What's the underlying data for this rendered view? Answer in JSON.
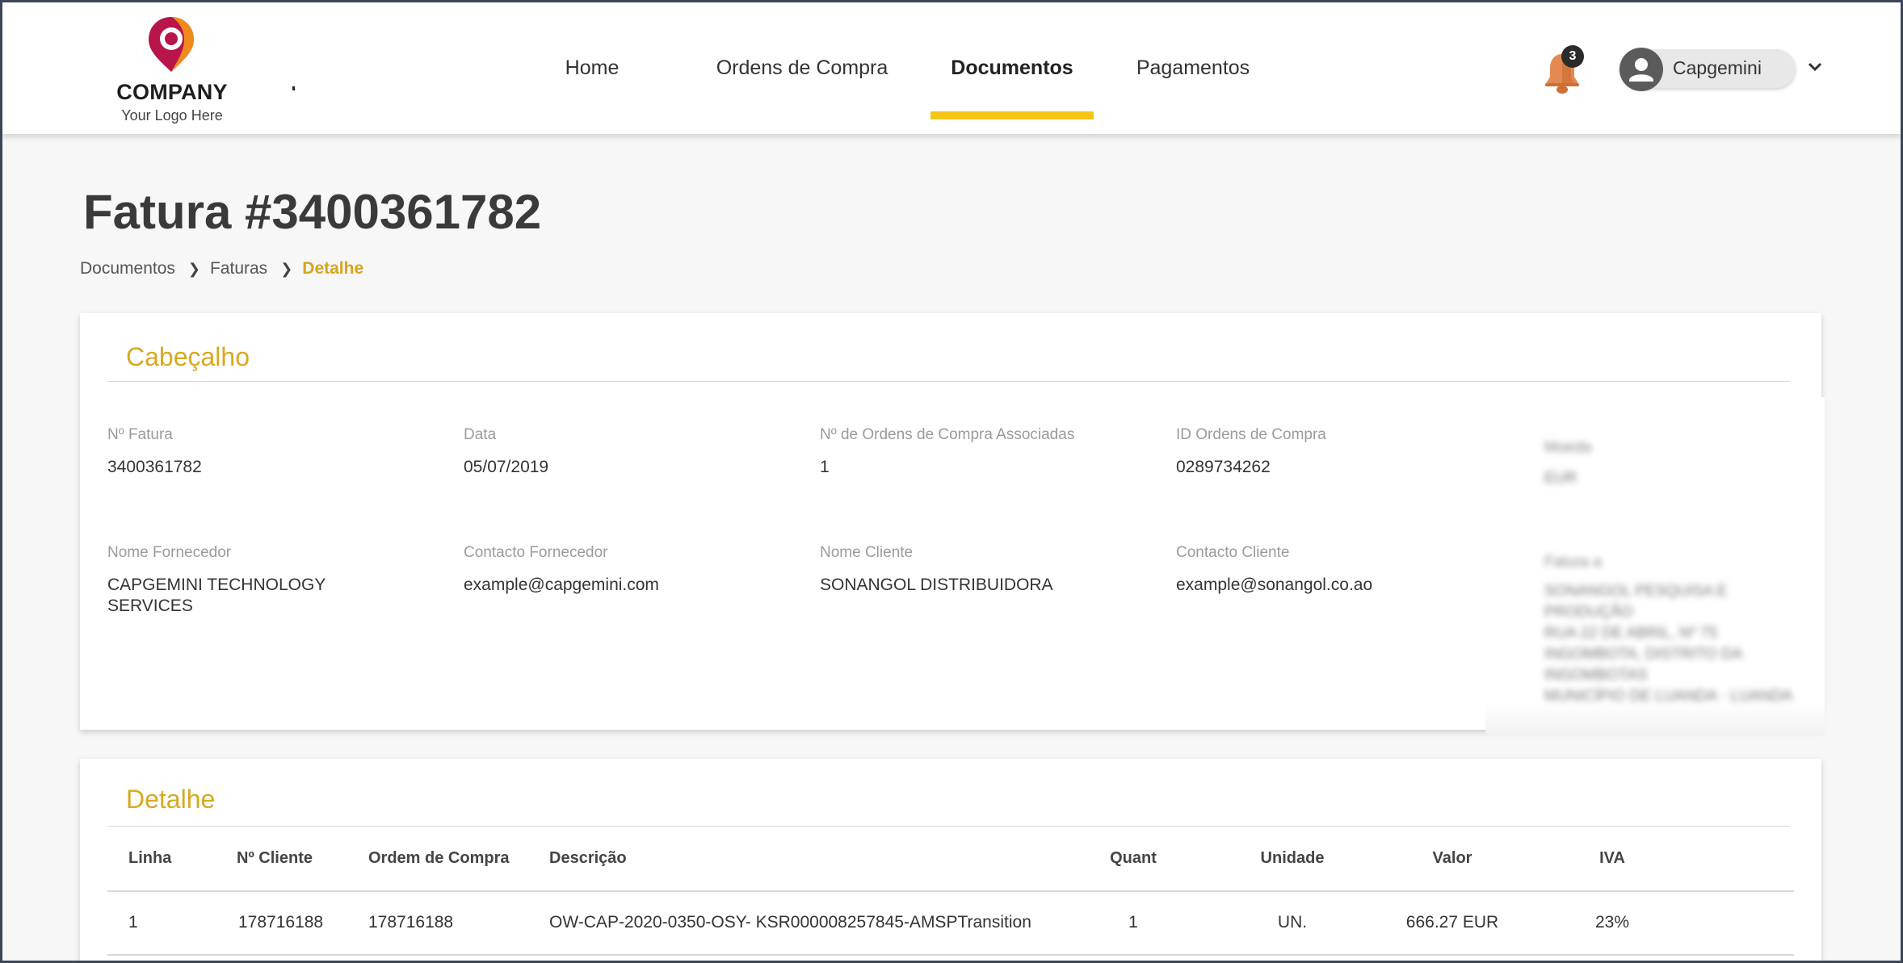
{
  "header": {
    "logo": {
      "company": "COMPANY",
      "tagline": "Your Logo Here"
    },
    "nav": [
      {
        "label": "Home"
      },
      {
        "label": "Ordens de Compra"
      },
      {
        "label": "Documentos",
        "active": true
      },
      {
        "label": "Pagamentos"
      }
    ],
    "notifications": {
      "count": "3"
    },
    "user": {
      "name": "Capgemini"
    }
  },
  "page": {
    "title": "Fatura #3400361782",
    "breadcrumb": [
      "Documentos",
      "Faturas",
      "Detalhe"
    ]
  },
  "cabecalho": {
    "title": "Cabeçalho",
    "fields": [
      {
        "label": "Nº Fatura",
        "value": "3400361782"
      },
      {
        "label": "Data",
        "value": "05/07/2019"
      },
      {
        "label": "Nº de Ordens de Compra Associadas",
        "value": "1"
      },
      {
        "label": "ID Ordens de Compra",
        "value": "0289734262"
      },
      {
        "label": "Nome Fornecedor",
        "value": "CAPGEMINI TECHNOLOGY\nSERVICES"
      },
      {
        "label": "Contacto Fornecedor",
        "value": "example@capgemini.com"
      },
      {
        "label": "Nome Cliente",
        "value": "SONANGOL DISTRIBUIDORA"
      },
      {
        "label": "Contacto Cliente",
        "value": "example@sonangol.co.ao"
      }
    ],
    "blurred": [
      {
        "label": "Moeda",
        "value": "EUR"
      },
      {
        "label": "Fatura a",
        "value": "SONANGOL PESQUISA E\nPRODUÇÃO\nRUA 22 DE ABRIL, Nº 75\nINGOMBOTA, DISTRITO DA\nINGOMBOTAS\nMUNICÍPIO DE LUANDA · LUANDA"
      }
    ]
  },
  "detalhe": {
    "title": "Detalhe",
    "columns": [
      "Linha",
      "Nº Cliente",
      "Ordem de Compra",
      "Descrição",
      "Quant",
      "Unidade",
      "Valor",
      "IVA"
    ],
    "rows": [
      [
        "1",
        "178716188",
        "178716188",
        "OW-CAP-2020-0350-OSY- KSR000008257845-AMSPTransition",
        "1",
        "UN.",
        "666.27 EUR",
        "23%"
      ]
    ]
  },
  "colors": {
    "accent": "#f5c518",
    "section_title": "#d7a91f",
    "breadcrumb_active": "#d4a51e"
  }
}
